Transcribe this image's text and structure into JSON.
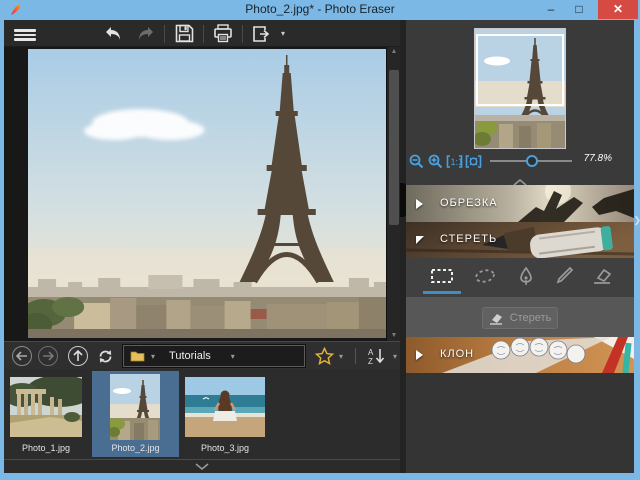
{
  "window": {
    "title": "Photo_2.jpg* - Photo Eraser"
  },
  "colors": {
    "titlebar": "#7cb8e6",
    "accent_blue": "#4aa0dc",
    "close_red": "#d64a44",
    "selected_thumb_bg": "#4a6d92",
    "star_gold": "#e0b23a",
    "folder_yellow": "#e5c05c"
  },
  "navigator": {
    "zoom_value": "77.8%",
    "zoom_slider_percent": 49
  },
  "panels": [
    {
      "id": "crop",
      "label": "ОБРЕЗКА",
      "expanded": false
    },
    {
      "id": "erase",
      "label": "СТЕРЕТЬ",
      "expanded": true,
      "button_label": "Стереть",
      "tools": [
        "rect-select",
        "lasso-select",
        "pen-select",
        "brush-select",
        "eraser-tool"
      ],
      "selected_tool": "rect-select"
    },
    {
      "id": "clone",
      "label": "КЛОН",
      "expanded": false
    }
  ],
  "browser": {
    "folder_name": "Tutorials",
    "files": [
      {
        "name": "Photo_1.jpg",
        "selected": false
      },
      {
        "name": "Photo_2.jpg",
        "selected": true
      },
      {
        "name": "Photo_3.jpg",
        "selected": false
      }
    ]
  }
}
